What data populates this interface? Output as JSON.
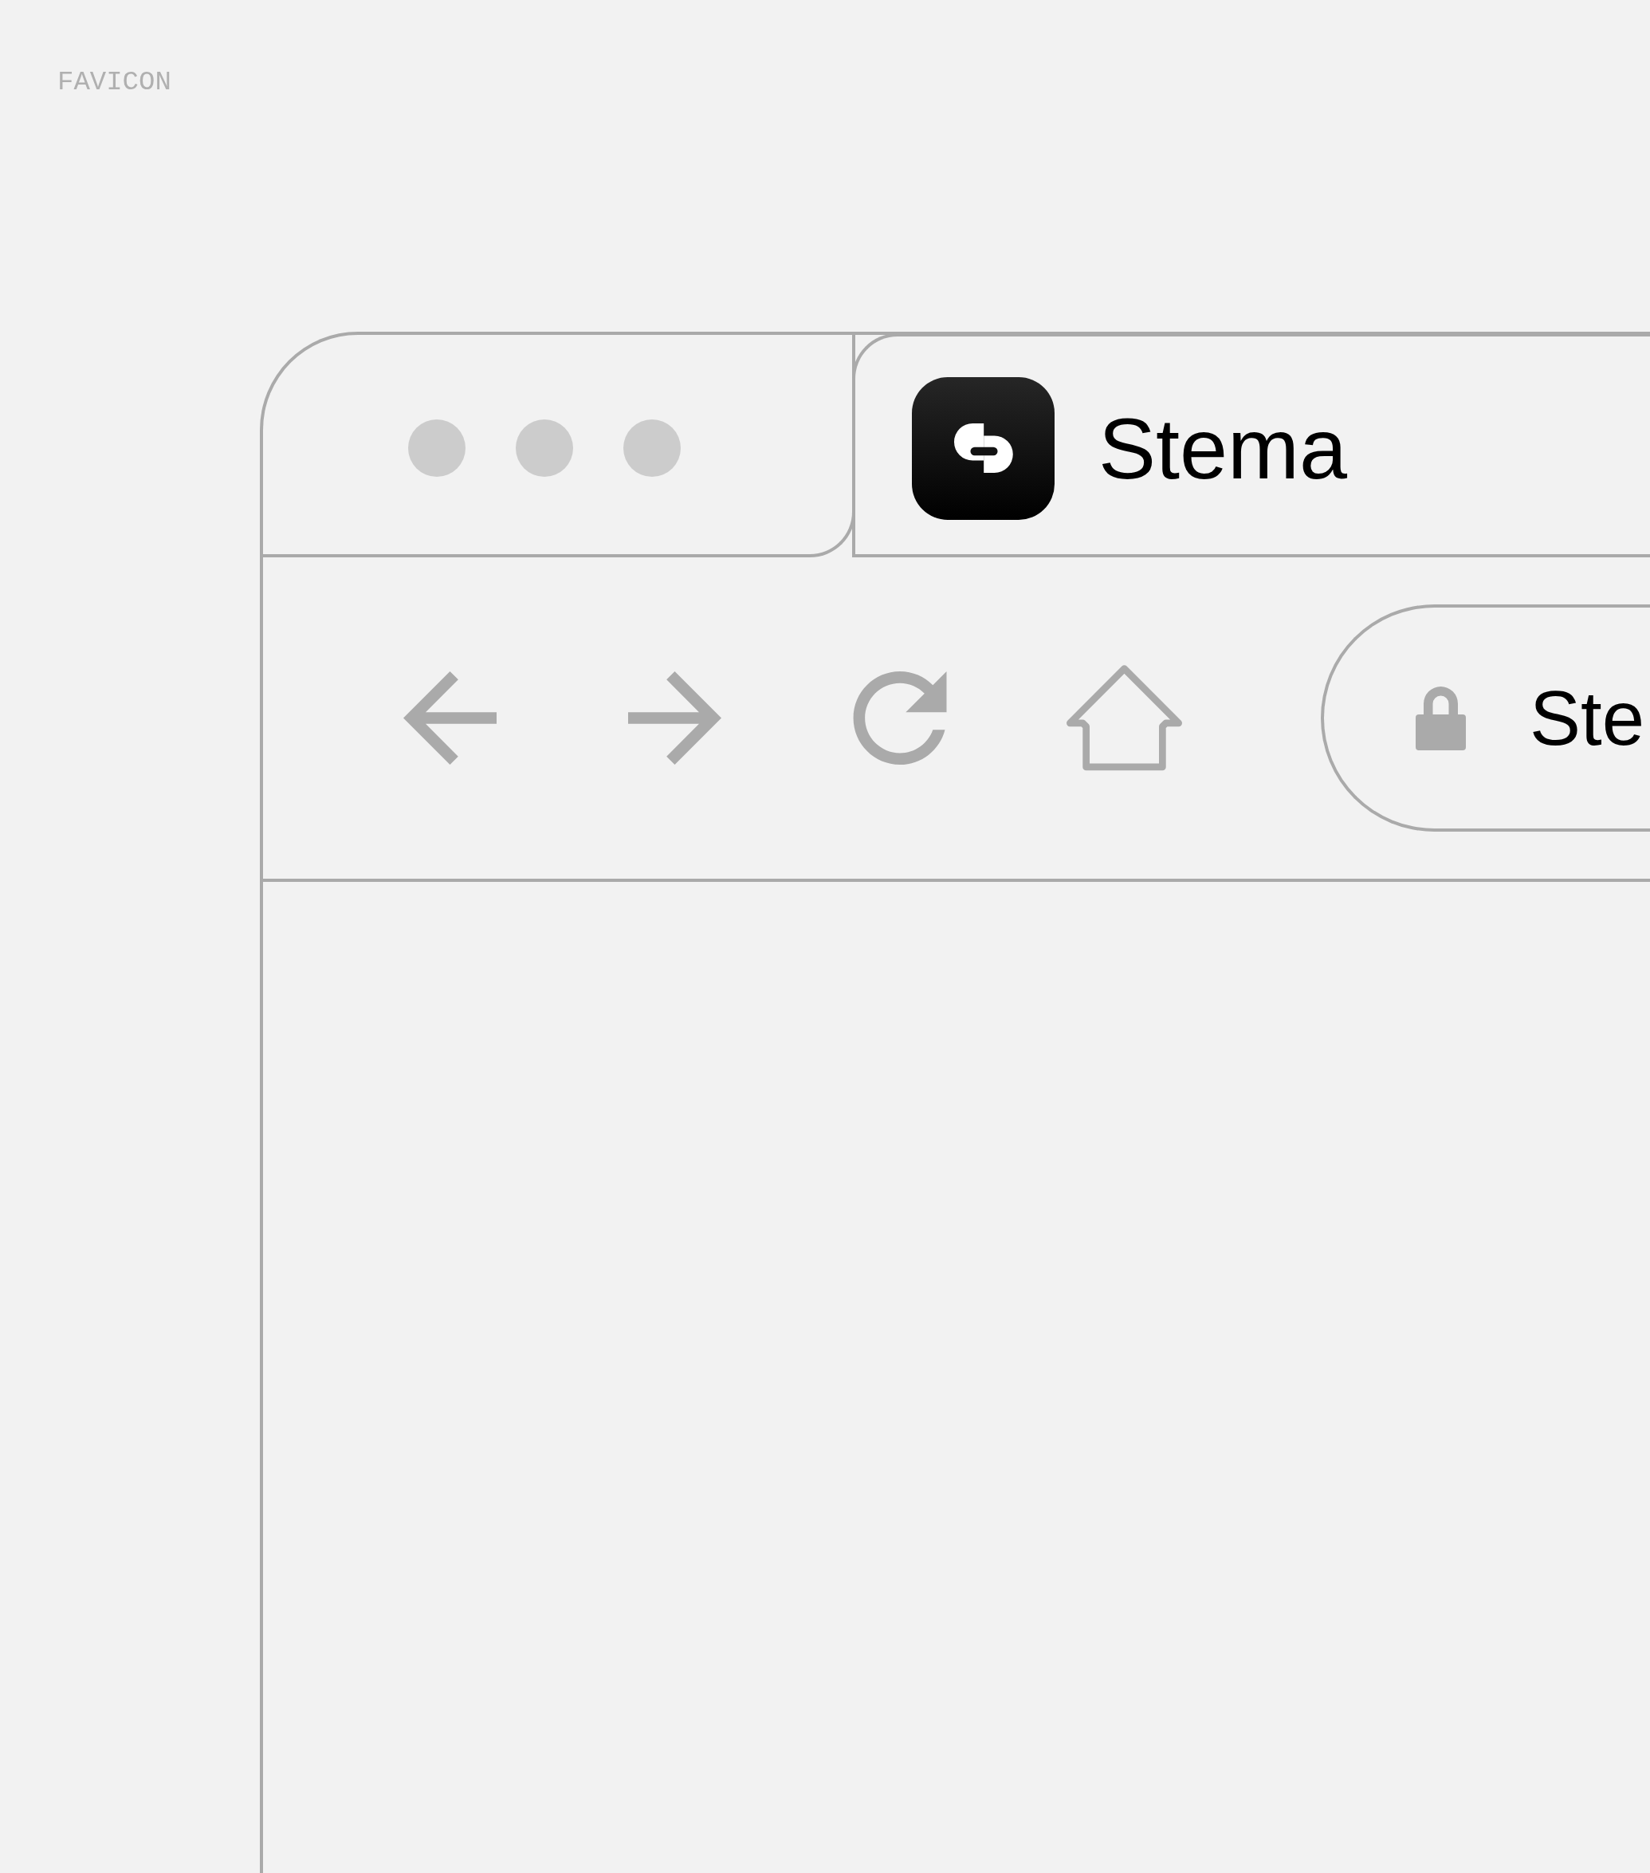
{
  "label": "FAVICON",
  "tabs": [
    {
      "title": "Stema",
      "selected": true
    }
  ],
  "address_bar": {
    "value": "Ste"
  }
}
